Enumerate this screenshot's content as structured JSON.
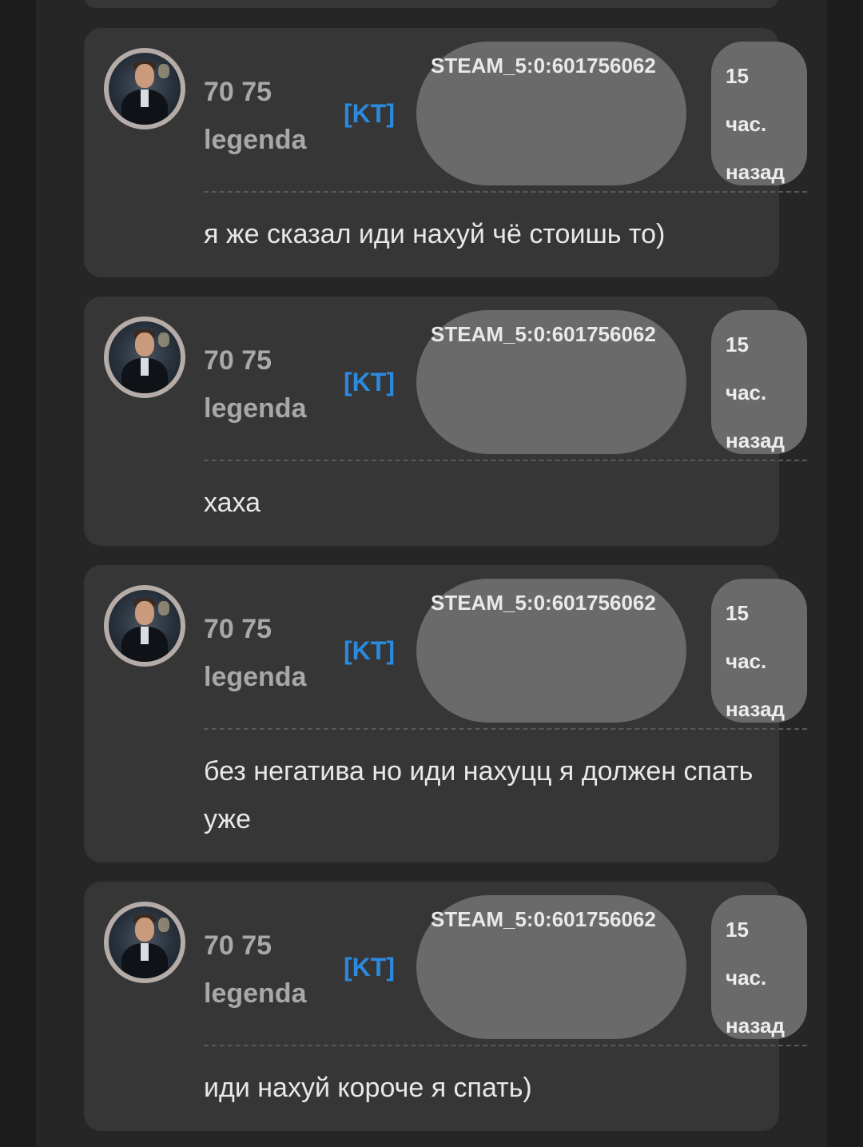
{
  "messages": [
    {
      "name": "70 75 legenda",
      "team": "[KT]",
      "steam_id": "STEAM_5:0:601756062",
      "time": [
        "15",
        "час.",
        "назад"
      ],
      "text": "я же сказал иди нахуй чё стоишь то)"
    },
    {
      "name": "70 75 legenda",
      "team": "[KT]",
      "steam_id": "STEAM_5:0:601756062",
      "time": [
        "15",
        "час.",
        "назад"
      ],
      "text": "хаха"
    },
    {
      "name": "70 75 legenda",
      "team": "[KT]",
      "steam_id": "STEAM_5:0:601756062",
      "time": [
        "15",
        "час.",
        "назад"
      ],
      "text": "без негатива но иди нахуцц я должен спать уже"
    },
    {
      "name": "70 75 legenda",
      "team": "[KT]",
      "steam_id": "STEAM_5:0:601756062",
      "time": [
        "15",
        "час.",
        "назад"
      ],
      "text": "иди нахуй короче я спать)"
    }
  ]
}
